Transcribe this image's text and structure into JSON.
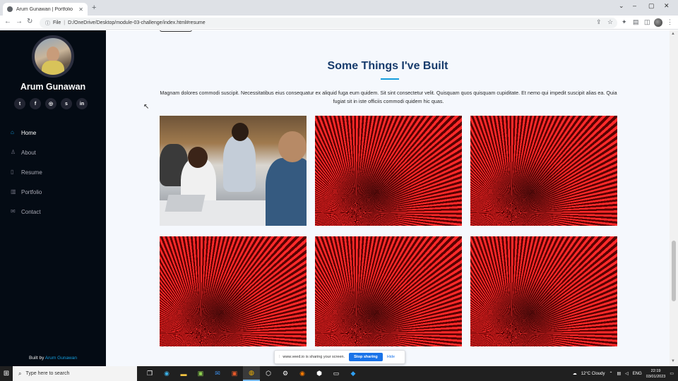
{
  "browser": {
    "tab_title": "Arum Gunawan | Portfolio",
    "tab_close": "✕",
    "new_tab": "+",
    "address_prefix": "File",
    "address_url": "D:/OneDrive/Desktop/module-03-challenge/index.html#resume"
  },
  "sidebar": {
    "name": "Arum Gunawan",
    "socials": [
      "twitter",
      "facebook",
      "instagram",
      "skype",
      "linkedin"
    ],
    "social_glyphs": [
      "t",
      "f",
      "◎",
      "s",
      "in"
    ],
    "nav": [
      {
        "label": "Home",
        "icon": "home-icon",
        "glyph": "⌂",
        "active": true
      },
      {
        "label": "About",
        "icon": "user-icon",
        "glyph": "♙",
        "active": false
      },
      {
        "label": "Resume",
        "icon": "file-icon",
        "glyph": "▯",
        "active": false
      },
      {
        "label": "Portfolio",
        "icon": "book-icon",
        "glyph": "▥",
        "active": false
      },
      {
        "label": "Contact",
        "icon": "envelope-icon",
        "glyph": "✉",
        "active": false
      }
    ],
    "built_by_prefix": "Built by",
    "built_by_link": "Arum Gunawan"
  },
  "main": {
    "section_title": "Some Things I've Built",
    "section_description": "Magnam dolores commodi suscipit. Necessitatibus eius consequatur ex aliquid fuga eum quidem. Sit sint consectetur velit. Quisquam quos quisquam cupiditate. Et nemo qui impedit suscipit alias ea. Quia fugiat sit in iste officiis commodi quidem hic quas.",
    "projects": [
      "team-photo",
      "red-abstract",
      "red-abstract",
      "red-abstract",
      "red-abstract",
      "red-abstract"
    ]
  },
  "share_bar": {
    "message": "www.veed.io is sharing your screen.",
    "stop_label": "Stop sharing",
    "hide_label": "Hide"
  },
  "taskbar": {
    "search_placeholder": "Type here to search",
    "weather": "12°C  Cloudy",
    "language": "ENG",
    "time": "22:19",
    "date": "03/01/2023"
  }
}
